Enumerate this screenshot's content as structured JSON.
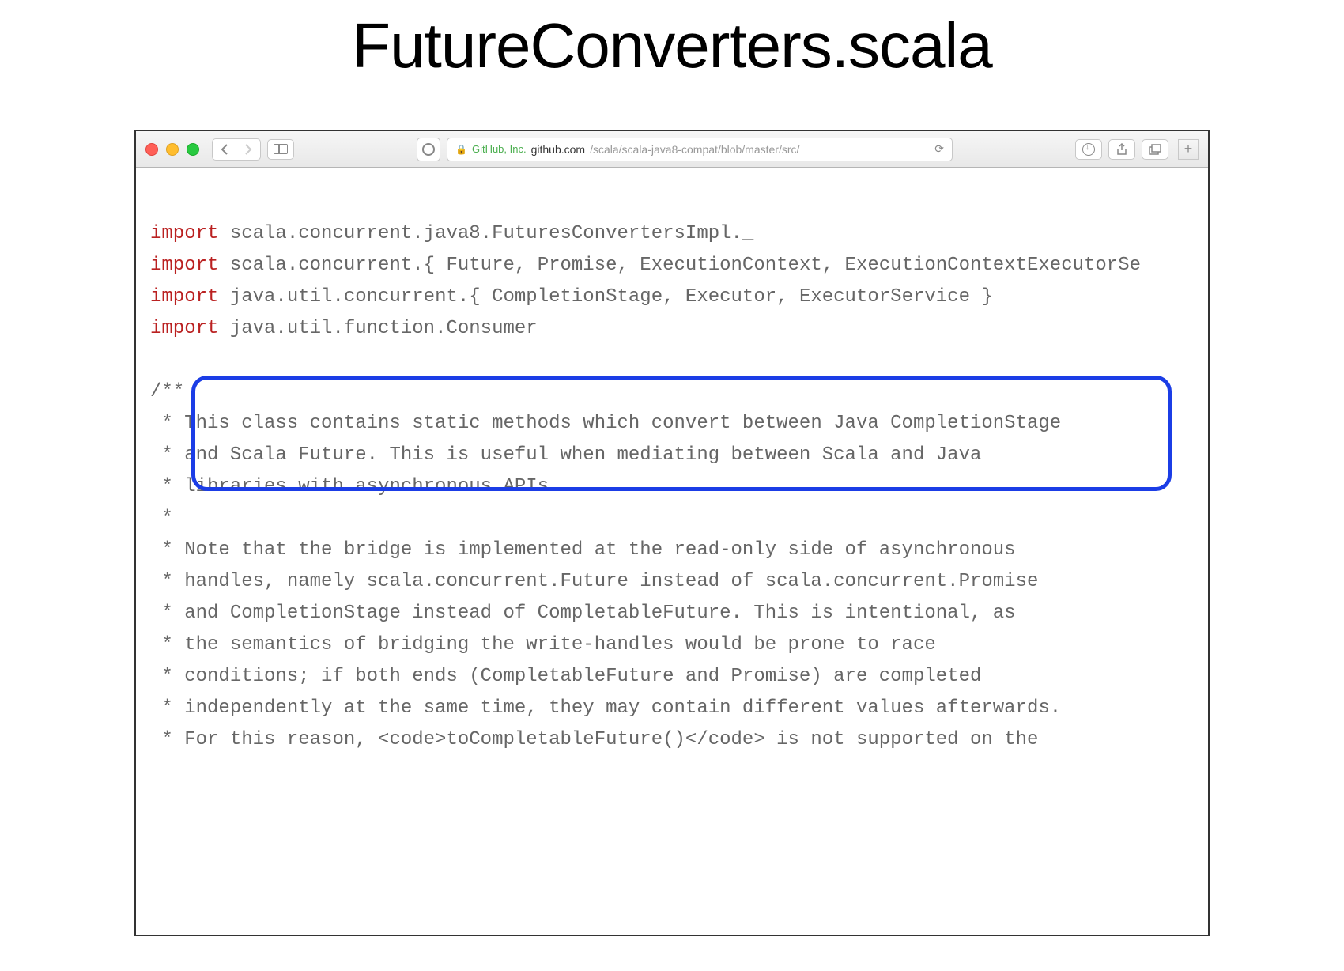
{
  "title": "FutureConverters.scala",
  "browser": {
    "url_company": "GitHub, Inc.",
    "url_domain": "github.com",
    "url_path": "/scala/scala-java8-compat/blob/master/src/"
  },
  "code": {
    "import_keyword": "import",
    "line1": " scala.concurrent.java8.FuturesConvertersImpl._",
    "line2": " scala.concurrent.{ Future, Promise, ExecutionContext, ExecutionContextExecutorSe",
    "line3": " java.util.concurrent.{ CompletionStage, Executor, ExecutorService }",
    "line4": " java.util.function.Consumer",
    "blank": "",
    "comment_open": "/**",
    "c1": " * This class contains static methods which convert between Java CompletionStage",
    "c2": " * and Scala Future. This is useful when mediating between Scala and Java",
    "c3": " * libraries with asynchronous APIs.",
    "c4": " *",
    "c5": " * Note that the bridge is implemented at the read-only side of asynchronous",
    "c6": " * handles, namely scala.concurrent.Future instead of scala.concurrent.Promise",
    "c7": " * and CompletionStage instead of CompletableFuture. This is intentional, as",
    "c8": " * the semantics of bridging the write-handles would be prone to race",
    "c9": " * conditions; if both ends (CompletableFuture and Promise) are completed",
    "c10": " * independently at the same time, they may contain different values afterwards.",
    "c11": " * For this reason, <code>toCompletableFuture()</code> is not supported on the"
  }
}
